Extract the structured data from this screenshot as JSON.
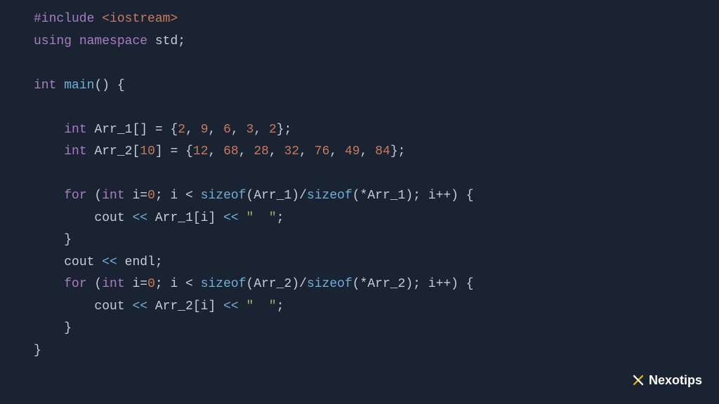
{
  "code": {
    "l1_include": "#include",
    "l1_header": "<iostream>",
    "l2_using": "using",
    "l2_namespace": "namespace",
    "l2_std": "std",
    "l4_int": "int",
    "l4_main": "main",
    "l4_parens": "()",
    "l4_brace": " {",
    "l6_int": "int",
    "l6_var": "Arr_1",
    "l6_bracket": "[]",
    "l6_eq": " = {",
    "l6_n1": "2",
    "l6_n2": "9",
    "l6_n3": "6",
    "l6_n4": "3",
    "l6_n5": "2",
    "l6_end": "};",
    "l7_int": "int",
    "l7_var": "Arr_2",
    "l7_size": "10",
    "l7_eq": " = {",
    "l7_n1": "12",
    "l7_n2": "68",
    "l7_n3": "28",
    "l7_n4": "32",
    "l7_n5": "76",
    "l7_n6": "49",
    "l7_n7": "84",
    "l7_end": "};",
    "l9_for": "for",
    "l9_int": "int",
    "l9_init": "i=",
    "l9_zero": "0",
    "l9_cond": " i < ",
    "l9_sizeof1": "sizeof",
    "l9_arg1": "(Arr_1)/",
    "l9_sizeof2": "sizeof",
    "l9_arg2": "(*Arr_1); i++) {",
    "l10_cout": "cout",
    "l10_op1": "<<",
    "l10_expr": " Arr_1[i] ",
    "l10_op2": "<<",
    "l10_str": "\"  \"",
    "l11_close": "}",
    "l12_cout": "cout",
    "l12_op": "<<",
    "l12_endl": " endl;",
    "l13_for": "for",
    "l13_int": "int",
    "l13_init": "i=",
    "l13_zero": "0",
    "l13_cond": " i < ",
    "l13_sizeof1": "sizeof",
    "l13_arg1": "(Arr_2)/",
    "l13_sizeof2": "sizeof",
    "l13_arg2": "(*Arr_2); i++) {",
    "l14_cout": "cout",
    "l14_op1": "<<",
    "l14_expr": " Arr_2[i] ",
    "l14_op2": "<<",
    "l14_str": "\"  \"",
    "l15_close": "}",
    "l16_close": "}",
    "comma": ", ",
    "semi": ";",
    "space": " "
  },
  "brand": "Nexotips"
}
